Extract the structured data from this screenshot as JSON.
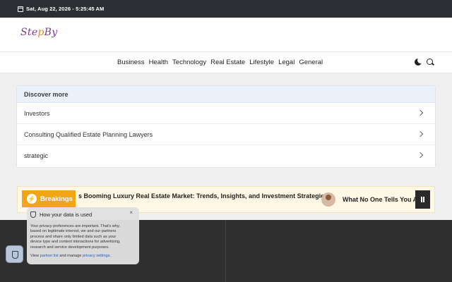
{
  "topbar": {
    "date": "Sat, Aug 22, 2026 - 5:25:45 AM"
  },
  "logo": {
    "text_a": "Ste",
    "text_o": "p",
    "text_b": "By"
  },
  "nav": {
    "items": [
      "Business",
      "Health",
      "Technology",
      "Real Estate",
      "Lifestyle",
      "Legal",
      "General"
    ]
  },
  "discover": {
    "title": "Discover more",
    "items": [
      "Investors",
      "Consulting Qualified Estate Planning Lawyers",
      "strategic"
    ]
  },
  "breaking": {
    "label": "Breakings",
    "headline1": "s Booming Luxury Real Estate Market: Trends, Insights, and Investment Strategies",
    "headline2": "What No One Tells You Ab"
  },
  "consent": {
    "title": "How your data is used",
    "body": "Your privacy preferences are important. That's why, based on legitimate interest, we and our partners process and share only limited data such as your device type and content interactions for advertising, research and service development purposes.",
    "view": "View",
    "partner_link": "partner list",
    "and_manage": "and manage",
    "privacy_link": "privacy settings",
    "end": "."
  },
  "colors": {
    "accent": "#f2a516",
    "topbar": "#2b2e33",
    "footer": "#2f2f2f"
  }
}
